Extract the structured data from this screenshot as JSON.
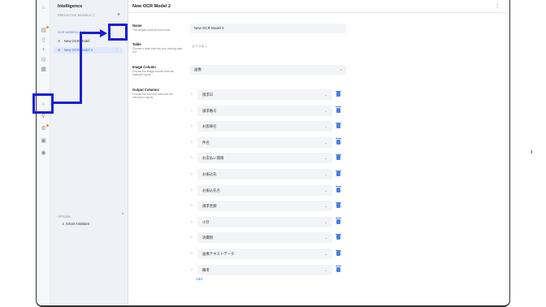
{
  "app": {
    "title": "Intelligence",
    "page_title": "New OCR Model 2"
  },
  "sidebar": {
    "section_label": "PREDICTIVE MODELS",
    "group_label": "OCR MODELS (1-4)",
    "items": [
      {
        "label": "New OCR Model"
      },
      {
        "label": "New OCR Model 2"
      }
    ],
    "options_label": "OPTIONS",
    "smart_assistant": "Smart Assistant"
  },
  "form": {
    "name_label": "Name",
    "name_hint": "The unique name for this model",
    "name_value": "New OCR Model 2",
    "table_label": "Table",
    "table_hint": "Choose a table that has your training data in it.",
    "table_value": "シート1",
    "image_label": "Image Column",
    "image_hint": "Choose the image column that has example inputs.",
    "image_value": "画像",
    "output_label": "Output Columns",
    "output_hint": "Choose the columns that have the extracted outputs.",
    "output_columns": [
      "請求日",
      "請求番号",
      "お客様名",
      "件名",
      "お支払い期限",
      "お振込先",
      "お振込先名",
      "請求金額",
      "小計",
      "消費税",
      "画像テキストデータ",
      "備考"
    ],
    "add_label": "Add"
  },
  "colors": {
    "annotation": "#1b1ed6",
    "accent": "#3d6fd0",
    "badge": "#f08c2a"
  }
}
